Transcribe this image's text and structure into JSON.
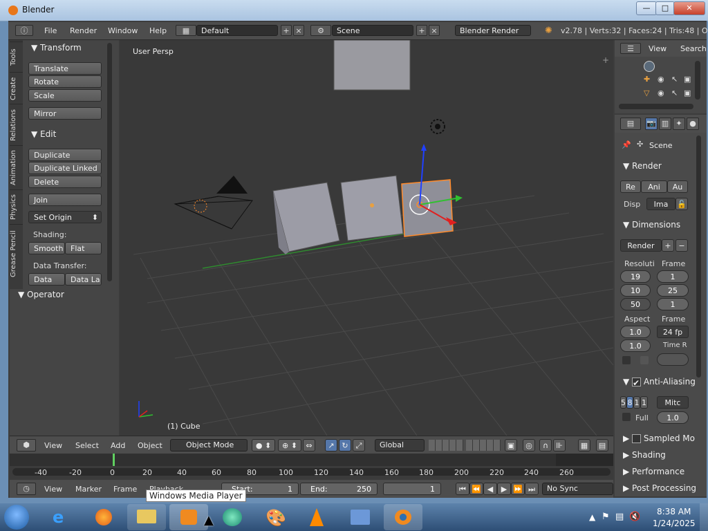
{
  "window": {
    "title": "Blender",
    "minimize": "—",
    "maximize": "□",
    "close": "✕"
  },
  "menu": [
    "File",
    "Render",
    "Window",
    "Help"
  ],
  "layout_field": "Default",
  "scene_field": "Scene",
  "engine": "Blender Render",
  "stats": "v2.78 | Verts:32 | Faces:24 | Tris:48 | Obje",
  "vtabs": [
    "Tools",
    "Create",
    "Relations",
    "Animation",
    "Physics",
    "Grease Pencil"
  ],
  "toolshelf": {
    "transform_header": "Transform",
    "translate": "Translate",
    "rotate": "Rotate",
    "scale": "Scale",
    "mirror": "Mirror",
    "edit_header": "Edit",
    "duplicate": "Duplicate",
    "duplicate_linked": "Duplicate Linked",
    "delete": "Delete",
    "join": "Join",
    "set_origin": "Set Origin",
    "shading_label": "Shading:",
    "smooth": "Smooth",
    "flat": "Flat",
    "data_transfer_label": "Data Transfer:",
    "data": "Data",
    "data_la": "Data La",
    "operator_header": "Operator"
  },
  "viewport": {
    "persp_label": "User Persp",
    "object_label": "(1) Cube"
  },
  "outliner": {
    "view": "View",
    "search": "Search"
  },
  "props": {
    "scene_label": "Scene",
    "render_header": "Render",
    "render_buttons": [
      "Re",
      "Ani",
      "Au"
    ],
    "disp_label": "Disp",
    "disp_value": "Ima",
    "dimensions_header": "Dimensions",
    "preset": "Render",
    "resolution_label": "Resoluti",
    "frame_label": "Frame",
    "res_x": "19",
    "res_y": "10",
    "res_pct": "50",
    "frame_start": "1",
    "frame_end": "25",
    "frame_step": "1",
    "aspect_label": "Aspect",
    "aspect_x": "1.0",
    "aspect_y": "1.0",
    "frame_label2": "Frame",
    "fps": "24 fp",
    "time_label": "Time R",
    "aa_header": "Anti-Aliasing",
    "aa_samples": [
      "5",
      "8",
      "1",
      "1"
    ],
    "aa_filter": "Mitc",
    "full_label": "Full",
    "aa_size": "1.0",
    "sampled_header": "Sampled Mo",
    "shading_header": "Shading",
    "performance_header": "Performance",
    "post_header": "Post Processing"
  },
  "viewhdr": {
    "view": "View",
    "select": "Select",
    "add": "Add",
    "object": "Object",
    "mode": "Object Mode",
    "orientation": "Global"
  },
  "timeline": {
    "ticks": [
      "-40",
      "-20",
      "0",
      "20",
      "40",
      "60",
      "80",
      "100",
      "120",
      "140",
      "160",
      "180",
      "200",
      "220",
      "240",
      "260"
    ]
  },
  "timehdr": {
    "view": "View",
    "marker": "Marker",
    "frame": "Frame",
    "playback": "Playback",
    "start_label": "Start:",
    "start": "1",
    "end_label": "End:",
    "end": "250",
    "current": "1",
    "sync": "No Sync"
  },
  "tooltip": "Windows Media Player",
  "taskbar": {
    "time": "8:38 AM",
    "date": "1/24/2025"
  },
  "colors": {
    "selected_outline": "#ff8a2a",
    "x_axis": "#e02020",
    "y_axis": "#30c030",
    "z_axis": "#2040ff"
  }
}
